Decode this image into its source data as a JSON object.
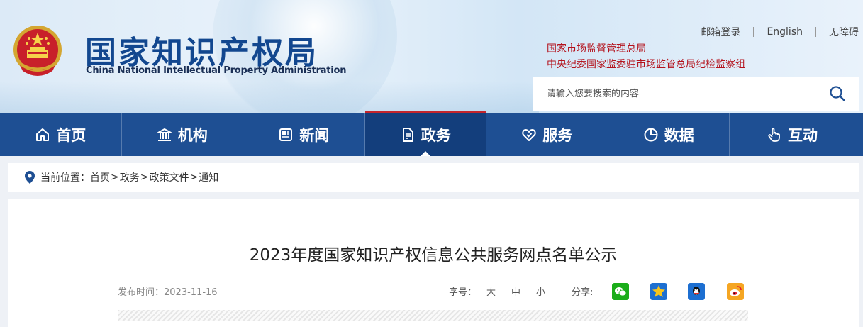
{
  "header": {
    "brand_cn": "国家知识产权局",
    "brand_en": "China National Intellectual Property Administration",
    "emblem_icon": "national-emblem",
    "top_links": [
      {
        "label": "邮箱登录"
      },
      {
        "label": "English"
      },
      {
        "label": "无障碍"
      }
    ],
    "orgs": [
      "国家市场监督管理总局",
      "中央纪委国家监委驻市场监管总局纪检监察组"
    ],
    "search": {
      "placeholder": "请输入您要搜索的内容",
      "button_icon": "search-icon"
    }
  },
  "nav": {
    "items": [
      {
        "label": "首页",
        "icon": "home-icon",
        "active": false
      },
      {
        "label": "机构",
        "icon": "institution-icon",
        "active": false
      },
      {
        "label": "新闻",
        "icon": "news-icon",
        "active": false
      },
      {
        "label": "政务",
        "icon": "document-icon",
        "active": true
      },
      {
        "label": "服务",
        "icon": "heart-hand-icon",
        "active": false
      },
      {
        "label": "数据",
        "icon": "pie-chart-icon",
        "active": false
      },
      {
        "label": "互动",
        "icon": "hand-pointer-icon",
        "active": false
      }
    ]
  },
  "breadcrumb": {
    "prefix": "当前位置：",
    "items": [
      "首页",
      "政务",
      "政策文件",
      "通知"
    ],
    "separator": ">"
  },
  "article": {
    "title": "2023年度国家知识产权信息公共服务网点名单公示",
    "date": "发布时间：2023-11-16",
    "font_size_label": "字号：",
    "font_sizes": [
      "大",
      "中",
      "小"
    ],
    "share_label": "分享:",
    "share_targets": [
      "wechat-icon",
      "qzone-icon",
      "qq-icon",
      "weibo-icon"
    ]
  },
  "colors": {
    "nav_bg": "#1e4f93",
    "nav_active_bg": "#133e7c",
    "accent_red": "#c4252c",
    "brand_blue": "#12478f",
    "org_red": "#b4121c"
  }
}
